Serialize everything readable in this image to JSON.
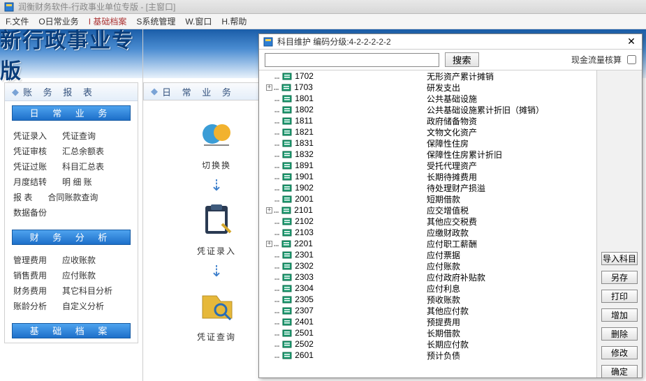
{
  "titlebar": {
    "title": "润衡财务软件-行政事业单位专版 - [主窗口]"
  },
  "menu": {
    "file": "F.文件",
    "daily": "O日常业务",
    "basic": "I 基础档案",
    "system": "S系统管理",
    "window": "W.窗口",
    "help": "H.帮助"
  },
  "banner": "新行政事业专版",
  "panels": {
    "left_header": "账 务 报 表",
    "center_header": "日 常 业 务",
    "sections": {
      "daily": "日 常 业 务",
      "analysis": "财 务 分 析",
      "basic": "基 础 档 案"
    },
    "daily_links": [
      [
        "凭证录入",
        "凭证查询"
      ],
      [
        "凭证审核",
        "汇总余额表"
      ],
      [
        "凭证过账",
        "科目汇总表"
      ],
      [
        "月度结转",
        "明 细 账"
      ],
      [
        "报    表",
        "合同账款查询"
      ],
      [
        "数据备份",
        ""
      ]
    ],
    "analysis_links": [
      [
        "管理费用",
        "应收账款"
      ],
      [
        "销售费用",
        "应付账款"
      ],
      [
        "财务费用",
        "其它科目分析"
      ],
      [
        "账龄分析",
        "自定义分析"
      ]
    ]
  },
  "center_icons": {
    "switch": "切换换",
    "entry": "凭证录入",
    "query": "凭证查询"
  },
  "dialog": {
    "title": "科目维护  编码分级:4-2-2-2-2-2",
    "search_btn": "搜索",
    "cashflow_label": "现金流量核算",
    "search_value": "",
    "actions": {
      "import": "导入科目",
      "savenew": "另存",
      "print": "打印",
      "add": "增加",
      "delete": "删除",
      "modify": "修改",
      "ok": "确定"
    },
    "tree": [
      {
        "exp": "",
        "code": "1702",
        "name": "无形资产累计摊销"
      },
      {
        "exp": "+",
        "code": "1703",
        "name": "研发支出"
      },
      {
        "exp": "",
        "code": "1801",
        "name": "公共基础设施"
      },
      {
        "exp": "",
        "code": "1802",
        "name": "公共基础设施累计折旧（摊销）"
      },
      {
        "exp": "",
        "code": "1811",
        "name": "政府储备物资"
      },
      {
        "exp": "",
        "code": "1821",
        "name": "文物文化资产"
      },
      {
        "exp": "",
        "code": "1831",
        "name": "保障性住房"
      },
      {
        "exp": "",
        "code": "1832",
        "name": "保障性住房累计折旧"
      },
      {
        "exp": "",
        "code": "1891",
        "name": "受托代理资产"
      },
      {
        "exp": "",
        "code": "1901",
        "name": "长期待摊费用"
      },
      {
        "exp": "",
        "code": "1902",
        "name": "待处理财产损溢"
      },
      {
        "exp": "",
        "code": "2001",
        "name": "短期借款"
      },
      {
        "exp": "+",
        "code": "2101",
        "name": "应交增值税"
      },
      {
        "exp": "",
        "code": "2102",
        "name": "其他应交税费"
      },
      {
        "exp": "",
        "code": "2103",
        "name": "应缴财政款"
      },
      {
        "exp": "+",
        "code": "2201",
        "name": "应付职工薪酬"
      },
      {
        "exp": "",
        "code": "2301",
        "name": "应付票据"
      },
      {
        "exp": "",
        "code": "2302",
        "name": "应付账款"
      },
      {
        "exp": "",
        "code": "2303",
        "name": "应付政府补贴款"
      },
      {
        "exp": "",
        "code": "2304",
        "name": "应付利息"
      },
      {
        "exp": "",
        "code": "2305",
        "name": "预收账款"
      },
      {
        "exp": "",
        "code": "2307",
        "name": "其他应付款"
      },
      {
        "exp": "",
        "code": "2401",
        "name": "预提费用"
      },
      {
        "exp": "",
        "code": "2501",
        "name": "长期借款"
      },
      {
        "exp": "",
        "code": "2502",
        "name": "长期应付款"
      },
      {
        "exp": "",
        "code": "2601",
        "name": "预计负债"
      }
    ]
  }
}
